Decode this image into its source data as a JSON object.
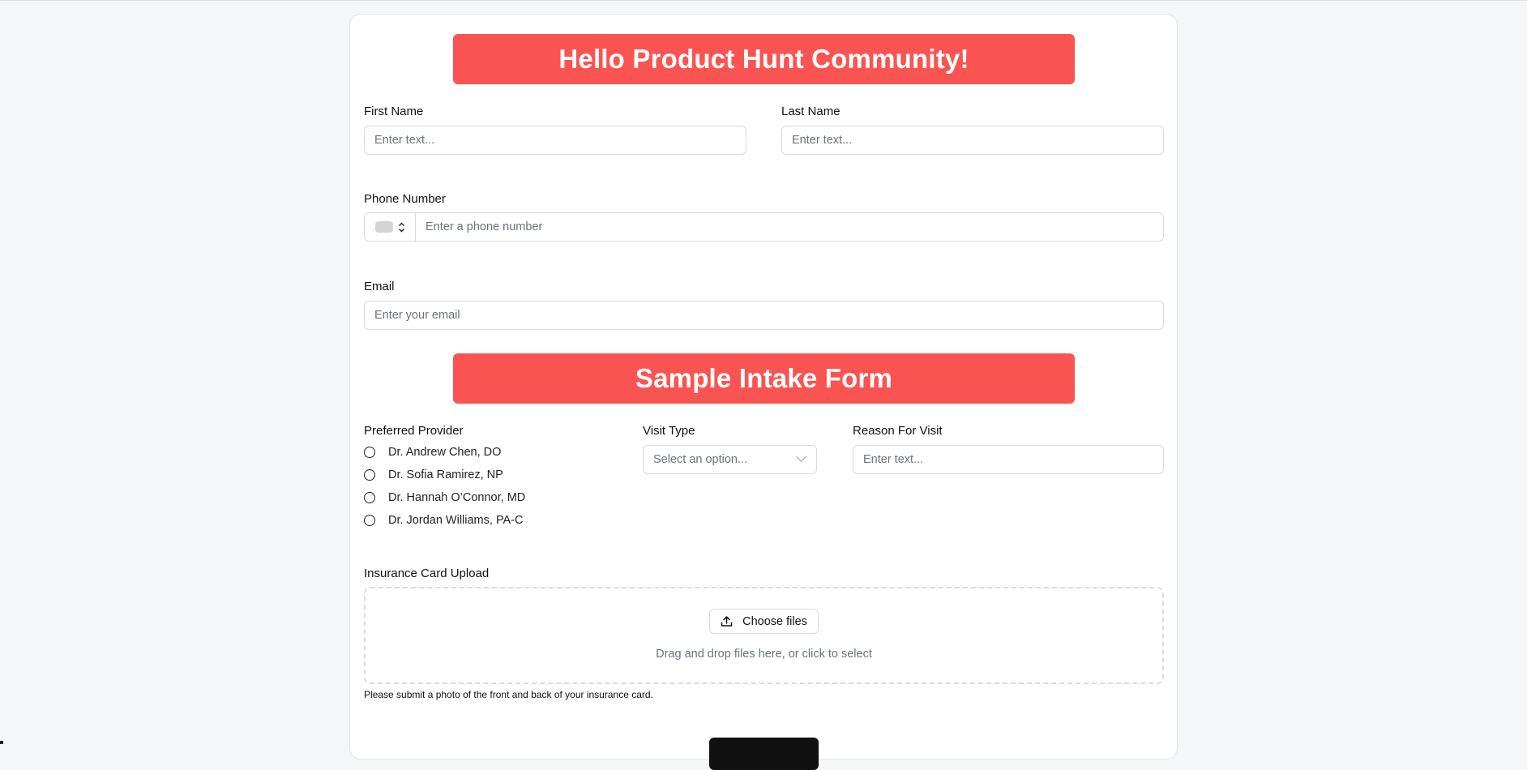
{
  "form": {
    "welcome_banner": "Hello Product Hunt Community!",
    "first_name": {
      "label": "First Name",
      "placeholder": "Enter text..."
    },
    "last_name": {
      "label": "Last Name",
      "placeholder": "Enter text..."
    },
    "phone": {
      "label": "Phone Number",
      "placeholder": "Enter a phone number"
    },
    "email": {
      "label": "Email",
      "placeholder": "Enter your email"
    },
    "section_banner": "Sample Intake Form",
    "preferred_provider": {
      "label": "Preferred Provider",
      "options": [
        "Dr. Andrew Chen, DO",
        "Dr. Sofia Ramirez, NP",
        "Dr. Hannah O’Connor, MD",
        "Dr. Jordan Williams, PA-C"
      ]
    },
    "visit_type": {
      "label": "Visit Type",
      "placeholder": "Select an option..."
    },
    "reason": {
      "label": "Reason For Visit",
      "placeholder": "Enter text..."
    },
    "insurance": {
      "label": "Insurance Card Upload",
      "button": "Choose files",
      "drop_text": "Drag and drop files here, or click to select",
      "helper": "Please submit a photo of the front and back of your insurance card."
    }
  },
  "colors": {
    "banner": "#fa5452",
    "page_background": "#f5f6f8",
    "submit": "#111111"
  },
  "icons": {
    "upload": "upload-icon",
    "select_chevron": "chevron-down-icon",
    "phone_country_toggle": "chevron-updown-icon"
  }
}
